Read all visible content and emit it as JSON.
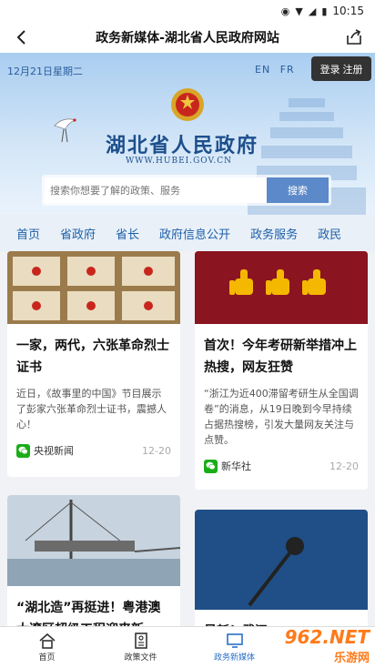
{
  "status_bar": {
    "time": "10:15"
  },
  "header": {
    "title": "政务新媒体-湖北省人民政府网站"
  },
  "hero": {
    "date": "12月21日星期二",
    "languages": [
      "EN",
      "FR"
    ],
    "login_label": "登录",
    "register_label": "注册",
    "site_name": "湖北省人民政府",
    "site_url": "WWW.HUBEI.GOV.CN"
  },
  "search": {
    "placeholder": "搜索你想要了解的政策、服务",
    "button_label": "搜索"
  },
  "nav_tabs": [
    "首页",
    "省政府",
    "省长",
    "政府信息公开",
    "政务服务",
    "政民"
  ],
  "cards": [
    {
      "headline": "一家，两代，六张革命烈士证书",
      "summary": "近日，《故事里的中国》节目展示了彭家六张革命烈士证书，震撼人心！",
      "source": "央视新闻",
      "date": "12-20"
    },
    {
      "headline": "首次！今年考研新举措冲上热搜，网友狂赞",
      "summary": "“浙江为近400滞留考研生从全国调卷”的消息，从19日晚到今早持续占据热搜榜，引发大量网友关注与点赞。",
      "source": "新华社",
      "date": "12-20"
    },
    {
      "headline": "“湖北造”再挺进！粤港澳大湾区超级工程迎来新"
    },
    {
      "headline": "最新！武汉"
    }
  ],
  "bottom_nav": [
    {
      "label": "首页"
    },
    {
      "label": "政策文件"
    },
    {
      "label": "政务新媒体"
    }
  ],
  "watermark": {
    "brand": "962.NET",
    "sub": "乐游网"
  },
  "colors": {
    "accent": "#2a70c8",
    "nav_text": "#1d5fa8",
    "wechat": "#1aad19"
  }
}
